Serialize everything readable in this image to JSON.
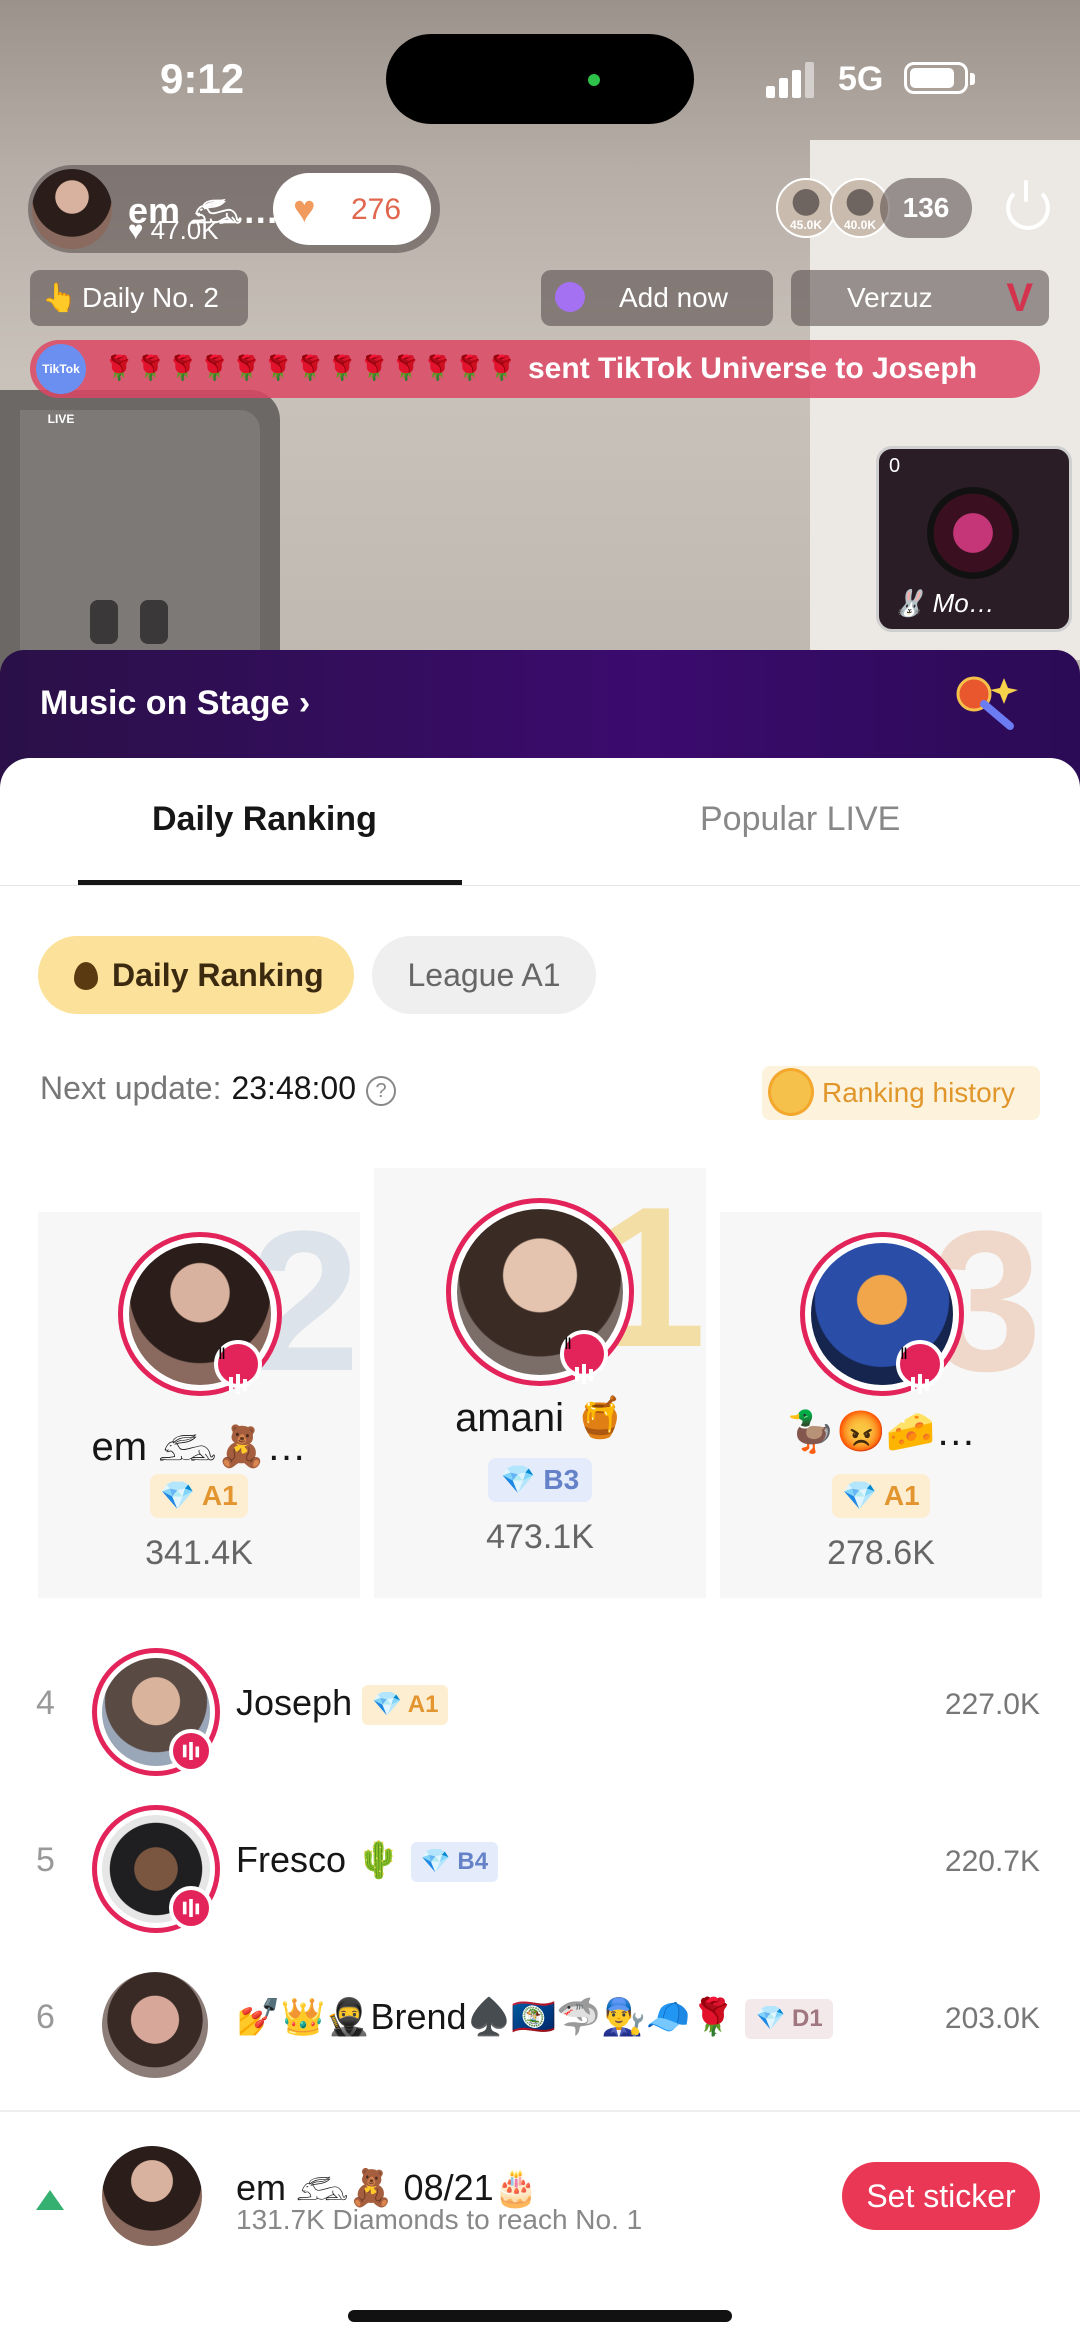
{
  "status_bar": {
    "time": "9:12",
    "network": "5G"
  },
  "host": {
    "name": "em 𓃹…",
    "likes": "♥ 47.0K",
    "follow_count": "276"
  },
  "viewers": {
    "avatar_1_label": "45.0K",
    "avatar_2_label": "40.0K",
    "count": "136"
  },
  "chips": {
    "daily": "Daily No. 2",
    "add_now": "Add now",
    "verzuz": "Verzuz"
  },
  "gift_banner": {
    "logo": "TikTok LIVE",
    "roses": "🌹🌹🌹🌹🌹🌹🌹🌹🌹🌹🌹🌹🌹",
    "message": "sent TikTok Universe to Joseph"
  },
  "cohost": {
    "count": "0",
    "name": "🐰 Mo…"
  },
  "stage": {
    "title": "Music on Stage ›"
  },
  "tabs": {
    "daily": "Daily Ranking",
    "popular": "Popular LIVE"
  },
  "filters": {
    "daily": "Daily Ranking",
    "league": "League A1"
  },
  "update": {
    "label": "Next update:",
    "time": "23:48:00",
    "history": "Ranking history"
  },
  "podium": [
    {
      "rank": "1",
      "name": "amani 🍯",
      "badge": "💎 B3",
      "score": "473.1K"
    },
    {
      "rank": "2",
      "name": "em 𓃹🧸…",
      "badge": "💎 A1",
      "score": "341.4K"
    },
    {
      "rank": "3",
      "name": "🦆😡🧀…",
      "badge": "💎 A1",
      "score": "278.6K"
    }
  ],
  "rows": [
    {
      "rank": "4",
      "name": "Joseph",
      "badge": "💎 A1",
      "score": "227.0K"
    },
    {
      "rank": "5",
      "name": "Fresco 🌵",
      "badge": "💎 B4",
      "score": "220.7K"
    },
    {
      "rank": "6",
      "name": "💅👑🥷Brend♠️🇧🇿🦈👨‍🔧🧢🌹",
      "badge": "💎 D1",
      "score": "203.0K"
    }
  ],
  "footer": {
    "name": "em 𓃹🧸 08/21🎂",
    "sub": "131.7K Diamonds to reach No. 1",
    "button": "Set sticker"
  },
  "colors": {
    "accent": "#ea3755",
    "gold_pill": "#fbe199",
    "stage_purple": "#3b0b6e"
  }
}
